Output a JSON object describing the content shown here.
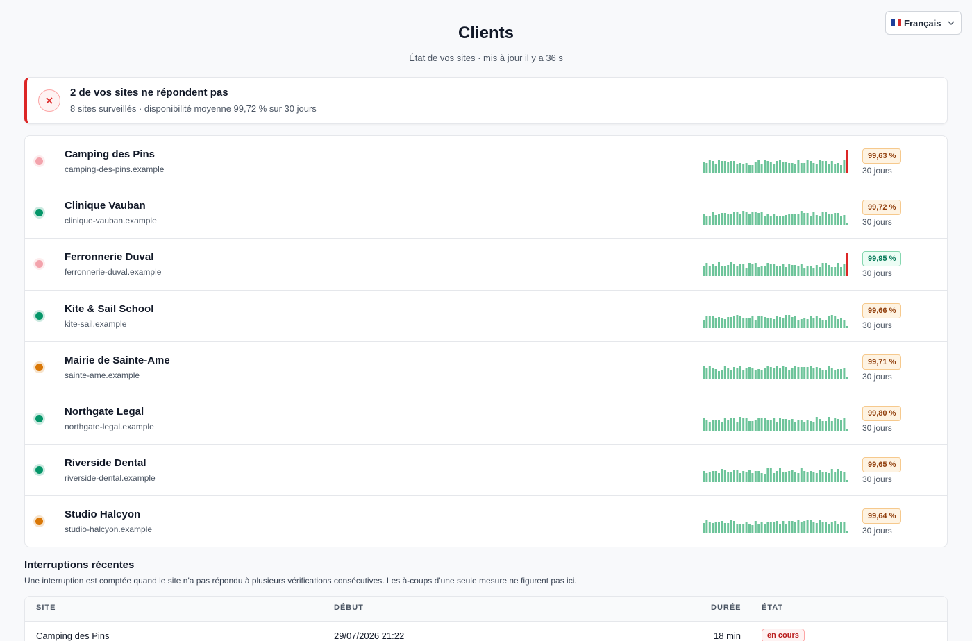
{
  "language_select": {
    "flag": "flag-fr",
    "label": "Français"
  },
  "page": {
    "title": "Clients",
    "subtitle": "État de vos sites · mis à jour il y a 36 s"
  },
  "alert": {
    "title": "2 de vos sites ne répondent pas",
    "subtitle": "8 sites surveillés · disponibilité moyenne 99,72 % sur 30 jours",
    "icon": "x-icon",
    "color": "#dc2626"
  },
  "colors": {
    "up": "#059669",
    "down": "#f3a3ac",
    "degraded": "#d97706",
    "bar": "#6dc49a",
    "bar_down": "#dc2626"
  },
  "sites": [
    {
      "name": "Camping des Pins",
      "host": "camping-des-pins.example",
      "status": "down",
      "uptime": "99,63 %",
      "badge": "warn",
      "period": "30 jours",
      "last_down": true
    },
    {
      "name": "Clinique Vauban",
      "host": "clinique-vauban.example",
      "status": "up",
      "uptime": "99,72 %",
      "badge": "warn",
      "period": "30 jours",
      "last_down": false
    },
    {
      "name": "Ferronnerie Duval",
      "host": "ferronnerie-duval.example",
      "status": "down",
      "uptime": "99,95 %",
      "badge": "good",
      "period": "30 jours",
      "last_down": true
    },
    {
      "name": "Kite & Sail School",
      "host": "kite-sail.example",
      "status": "up",
      "uptime": "99,66 %",
      "badge": "warn",
      "period": "30 jours",
      "last_down": false
    },
    {
      "name": "Mairie de Sainte-Ame",
      "host": "sainte-ame.example",
      "status": "degraded",
      "uptime": "99,71 %",
      "badge": "warn",
      "period": "30 jours",
      "last_down": false
    },
    {
      "name": "Northgate Legal",
      "host": "northgate-legal.example",
      "status": "up",
      "uptime": "99,80 %",
      "badge": "warn",
      "period": "30 jours",
      "last_down": false
    },
    {
      "name": "Riverside Dental",
      "host": "riverside-dental.example",
      "status": "up",
      "uptime": "99,65 %",
      "badge": "warn",
      "period": "30 jours",
      "last_down": false
    },
    {
      "name": "Studio Halcyon",
      "host": "studio-halcyon.example",
      "status": "degraded",
      "uptime": "99,64 %",
      "badge": "warn",
      "period": "30 jours",
      "last_down": false
    }
  ],
  "incidents": {
    "title": "Interruptions récentes",
    "note": "Une interruption est comptée quand le site n'a pas répondu à plusieurs vérifications consécutives. Les à-coups d'une seule mesure ne figurent pas ici.",
    "columns": {
      "site": "SITE",
      "start": "DÉBUT",
      "duration": "DURÉE",
      "state": "ÉTAT"
    },
    "rows": [
      {
        "site": "Camping des Pins",
        "start": "29/07/2026 21:22",
        "duration": "18 min",
        "state": "en cours"
      }
    ]
  }
}
